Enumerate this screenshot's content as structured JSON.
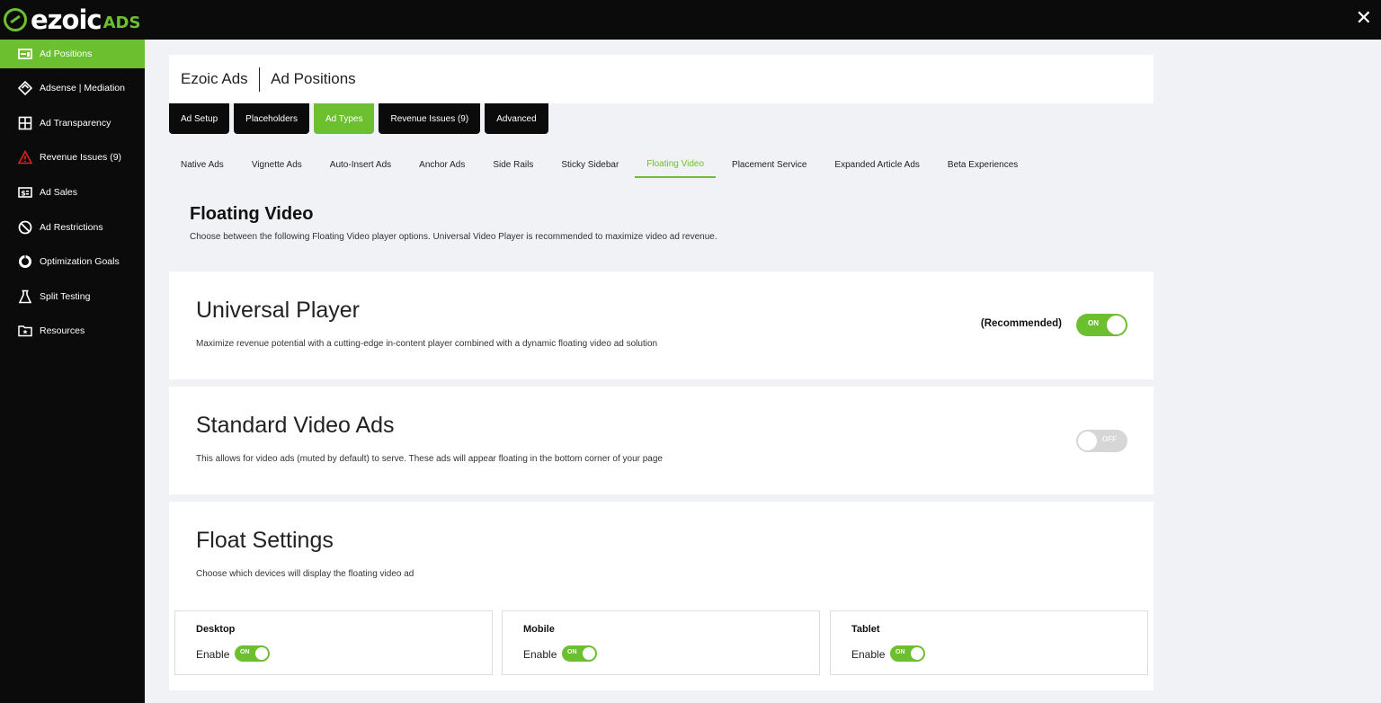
{
  "brand": {
    "logo_text": "ezoic",
    "logo_suffix": "ADS"
  },
  "window": {
    "close_glyph": "✕"
  },
  "colors": {
    "accent": "#6cbf2f",
    "dark": "#0b0b0b",
    "background": "#f1f2f5",
    "warning": "#e02020"
  },
  "sidebar": {
    "items": [
      {
        "label": "Ad Positions",
        "icon": "ad-positions-icon",
        "active": true
      },
      {
        "label": "Adsense | Mediation",
        "icon": "mediation-icon",
        "active": false
      },
      {
        "label": "Ad Transparency",
        "icon": "grid-icon",
        "active": false
      },
      {
        "label": "Revenue Issues (9)",
        "icon": "warning-icon",
        "active": false
      },
      {
        "label": "Ad Sales",
        "icon": "dollar-icon",
        "active": false
      },
      {
        "label": "Ad Restrictions",
        "icon": "ban-icon",
        "active": false
      },
      {
        "label": "Optimization Goals",
        "icon": "donut-icon",
        "active": false
      },
      {
        "label": "Split Testing",
        "icon": "flask-icon",
        "active": false
      },
      {
        "label": "Resources",
        "icon": "folder-star-icon",
        "active": false
      }
    ]
  },
  "header": {
    "brand": "Ezoic Ads",
    "page": "Ad Positions"
  },
  "tabs": [
    {
      "label": "Ad Setup",
      "active": false
    },
    {
      "label": "Placeholders",
      "active": false
    },
    {
      "label": "Ad Types",
      "active": true
    },
    {
      "label": "Revenue Issues (9)",
      "active": false
    },
    {
      "label": "Advanced",
      "active": false
    }
  ],
  "subtabs": [
    {
      "label": "Native Ads",
      "active": false
    },
    {
      "label": "Vignette Ads",
      "active": false
    },
    {
      "label": "Auto-Insert Ads",
      "active": false
    },
    {
      "label": "Anchor Ads",
      "active": false
    },
    {
      "label": "Side Rails",
      "active": false
    },
    {
      "label": "Sticky Sidebar",
      "active": false
    },
    {
      "label": "Floating Video",
      "active": true
    },
    {
      "label": "Placement Service",
      "active": false
    },
    {
      "label": "Expanded Article Ads",
      "active": false
    },
    {
      "label": "Beta Experiences",
      "active": false
    }
  ],
  "section": {
    "title": "Floating Video",
    "description": "Choose between the following Floating Video player options. Universal Video Player is recommended to maximize video ad revenue."
  },
  "universal_player": {
    "title": "Universal Player",
    "description": "Maximize revenue potential with a cutting-edge in-content player combined with a dynamic floating video ad solution",
    "badge": "(Recommended)",
    "toggle_label": "ON",
    "enabled": true
  },
  "standard_video": {
    "title": "Standard Video Ads",
    "description": "This allows for video ads (muted by default) to serve. These ads will appear floating in the bottom corner of your page",
    "toggle_label": "OFF",
    "enabled": false
  },
  "float_settings": {
    "title": "Float Settings",
    "description": "Choose which devices will display the floating video ad",
    "devices": [
      {
        "name": "Desktop",
        "enable_label": "Enable",
        "toggle_label": "ON",
        "enabled": true
      },
      {
        "name": "Mobile",
        "enable_label": "Enable",
        "toggle_label": "ON",
        "enabled": true
      },
      {
        "name": "Tablet",
        "enable_label": "Enable",
        "toggle_label": "ON",
        "enabled": true
      }
    ]
  }
}
